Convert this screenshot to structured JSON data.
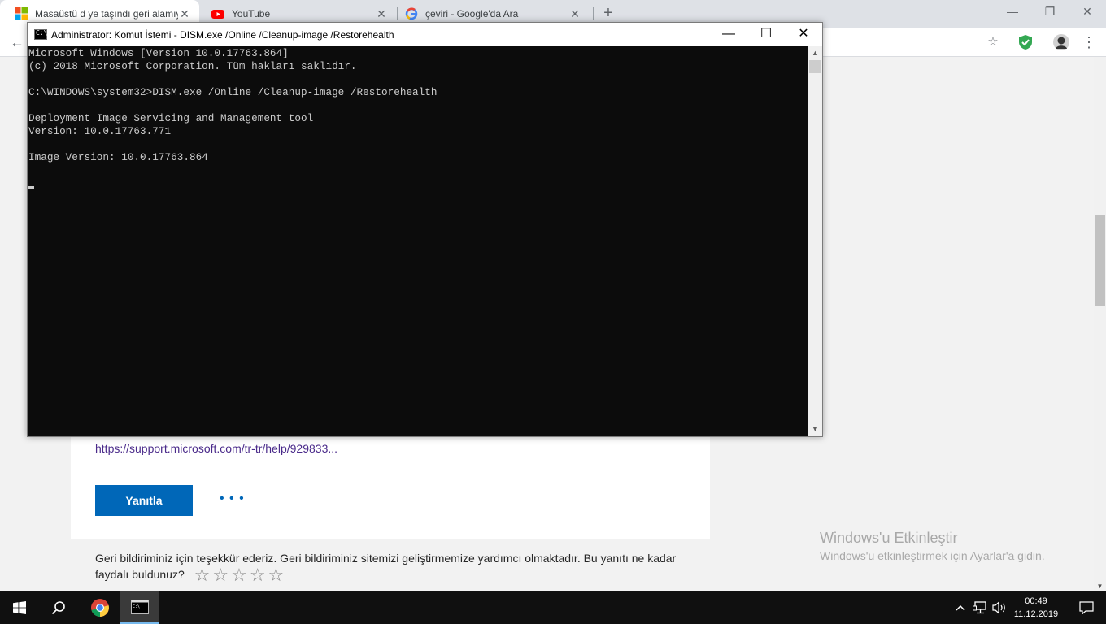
{
  "browser": {
    "tabs": [
      {
        "title": "Masaüstü d ye taşındı geri alamıy",
        "favicon": "microsoft-logo-icon",
        "active": true
      },
      {
        "title": "YouTube",
        "favicon": "youtube-icon",
        "active": false
      },
      {
        "title": "çeviri - Google'da Ara",
        "favicon": "google-icon",
        "active": false
      }
    ],
    "new_tab": "+",
    "window_controls": {
      "minimize": "—",
      "maximize": "❐",
      "close": "✕"
    },
    "toolbar": {
      "back": "←",
      "star": "☆",
      "more": "⋮"
    }
  },
  "page": {
    "support_link": "https://support.microsoft.com/tr-tr/help/929833...",
    "reply_button": "Yanıtla",
    "more_button": "• • •",
    "feedback_text": "Geri bildiriminiz için teşekkür ederiz. Geri bildiriminiz sitemizi geliştirmemize yardımcı olmaktadır. Bu yanıtı ne kadar faydalı buldunuz?",
    "stars": "☆☆☆☆☆",
    "rating": 0
  },
  "watermark": {
    "title": "Windows'u Etkinleştir",
    "subtitle": "Windows'u etkinleştirmek için Ayarlar'a gidin."
  },
  "cmd": {
    "title": "Administrator: Komut İstemi - DISM.exe  /Online /Cleanup-image /Restorehealth",
    "icon_text": "C:\\",
    "controls": {
      "minimize": "—",
      "maximize": "☐",
      "close": "✕"
    },
    "lines": [
      "Microsoft Windows [Version 10.0.17763.864]",
      "(c) 2018 Microsoft Corporation. Tüm hakları saklıdır.",
      "",
      "C:\\WINDOWS\\system32>DISM.exe /Online /Cleanup-image /Restorehealth",
      "",
      "Deployment Image Servicing and Management tool",
      "Version: 10.0.17763.771",
      "",
      "Image Version: 10.0.17763.864",
      ""
    ]
  },
  "taskbar": {
    "time": "00:49",
    "date": "11.12.2019"
  },
  "colors": {
    "accent_blue": "#0067b8",
    "console_bg": "#0c0c0c",
    "console_text": "#cccccc",
    "taskbar_bg": "#101010"
  }
}
